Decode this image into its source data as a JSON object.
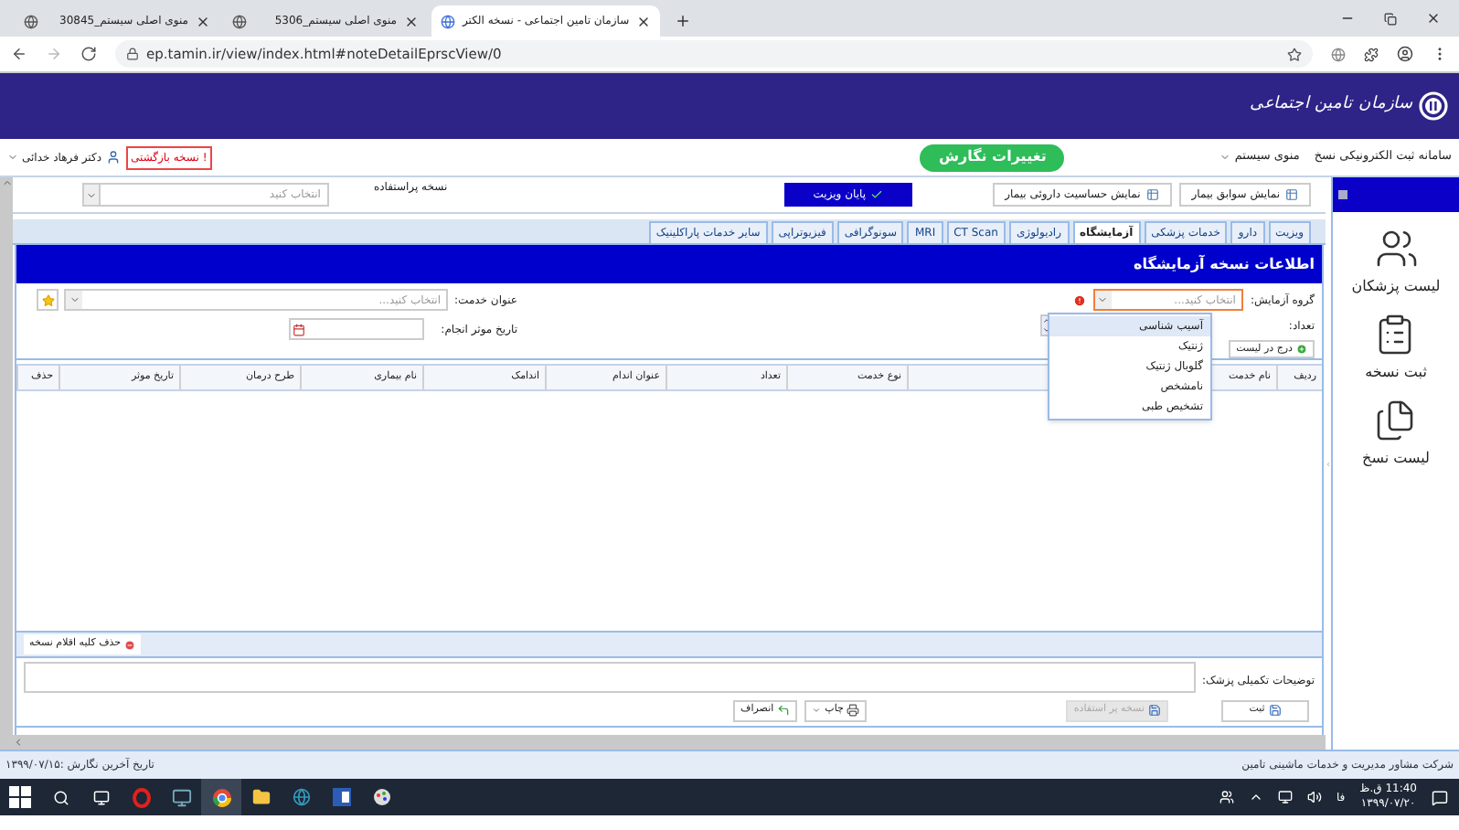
{
  "browser": {
    "tabs": [
      {
        "title": "سازمان تامین اجتماعی - نسخه الکتر",
        "selected": true
      },
      {
        "title": "منوی اصلی سیستم_5306",
        "selected": false
      },
      {
        "title": "منوی اصلی سیستم_30845",
        "selected": false
      }
    ],
    "url": "ep.tamin.ir/view/index.html#noteDetailEprscView/0"
  },
  "header": {
    "logo_text": "سازمان تامین اجتماعی"
  },
  "topbar": {
    "system_name": "سامانه ثبت الکترونیکی نسخ",
    "menu": "منوی سیستم",
    "action_button": "تغییرات نگارش",
    "returned_badge": "! نسخه بازگشتی",
    "user": "دکتر فرهاد خدائی"
  },
  "toolbar": {
    "buttons": [
      {
        "label": "نمایش سوابق بیمار",
        "kind": "secondary"
      },
      {
        "label": "نمایش حساسیت داروئی بیمار",
        "kind": "secondary"
      },
      {
        "label": "پایان ویزیت",
        "kind": "primary"
      }
    ],
    "frequent_label": "نسخه پراستفاده",
    "frequent_placeholder": "انتخاب کنید"
  },
  "tabs": [
    {
      "label": "ویزیت",
      "selected": false
    },
    {
      "label": "دارو",
      "selected": false
    },
    {
      "label": "خدمات پزشکی",
      "selected": false
    },
    {
      "label": "آزمایشگاه",
      "selected": true
    },
    {
      "label": "رادیولوژی",
      "selected": false
    },
    {
      "label": "CT Scan",
      "selected": false
    },
    {
      "label": "MRI",
      "selected": false
    },
    {
      "label": "سونوگرافی",
      "selected": false
    },
    {
      "label": "فیزیوتراپی",
      "selected": false
    },
    {
      "label": "سایر خدمات پاراکلینیک",
      "selected": false
    }
  ],
  "section_title": "اطلاعات نسخه آزمایشگاه",
  "form": {
    "group_label": "گروه آزمایش:",
    "group_placeholder": "انتخاب کنید...",
    "group_options": [
      {
        "label": "آسیب شناسی",
        "selected": true
      },
      {
        "label": "ژنتیک",
        "selected": false
      },
      {
        "label": "گلوبال ژنتیک",
        "selected": false
      },
      {
        "label": "نامشخص",
        "selected": false
      },
      {
        "label": "تشخیص طبی",
        "selected": false
      }
    ],
    "count_label": "تعداد:",
    "add_button": "درج در لیست",
    "service_label": "عنوان خدمت:",
    "service_placeholder": "انتخاب کنید...",
    "date_label": "تاریخ موثر انجام:"
  },
  "table": {
    "columns": [
      "ردیف",
      "نام خدمت",
      "نوع خدمت",
      "تعداد",
      "عنوان اندام",
      "اندامک",
      "نام بیماری",
      "طرح درمان",
      "تاریخ موثر",
      "حذف"
    ]
  },
  "delete_all_button": "حذف کلیه اقلام نسخه",
  "notes_label": "توضیحات تکمیلی پزشک:",
  "actions": [
    {
      "label": "ثبت",
      "kind": "save",
      "disabled": false
    },
    {
      "label": "نسخه پر استفاده",
      "kind": "save",
      "disabled": true
    },
    {
      "label": "چاپ",
      "kind": "print",
      "disabled": false
    },
    {
      "label": "انصراف",
      "kind": "cancel",
      "disabled": false
    }
  ],
  "sidebar": {
    "items": [
      "لیست پزشکان",
      "ثبت نسخه",
      "لیست نسخ"
    ]
  },
  "status_bar": {
    "company": "شرکت مشاور مدیریت و خدمات ماشینی تامین",
    "last_edit": "تاریخ آخرین نگارش :۱۳۹۹/۰۷/۱۵"
  },
  "taskbar": {
    "language": "فا",
    "time": "11:40 ق.ظ",
    "date": "۱۳۹۹/۰۷/۲۰"
  }
}
